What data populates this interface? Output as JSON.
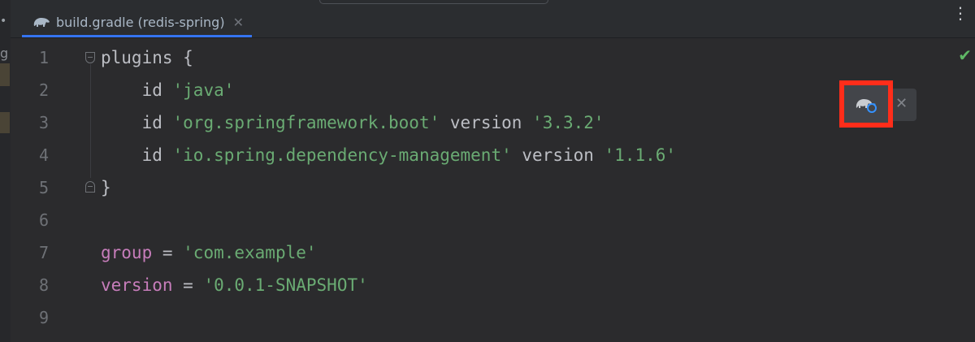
{
  "left_strip": {
    "letter": "g",
    "dot": "•"
  },
  "tab": {
    "title": "build.gradle (redis-spring)",
    "close": "✕",
    "icon": "gradle-elephant-icon"
  },
  "tabbar": {
    "more": "⋮"
  },
  "line_numbers": [
    "1",
    "2",
    "3",
    "4",
    "5",
    "6",
    "7",
    "8",
    "9"
  ],
  "code": {
    "l1": {
      "a": "plugins ",
      "b": "{"
    },
    "l2": {
      "a": "    id ",
      "b": "'java'"
    },
    "l3": {
      "a": "    id ",
      "b": "'org.springframework.boot'",
      "c": " version ",
      "d": "'3.3.2'"
    },
    "l4": {
      "a": "    id ",
      "b": "'io.spring.dependency-management'",
      "c": " version ",
      "d": "'1.1.6'"
    },
    "l5": {
      "a": "}"
    },
    "l7": {
      "a": "group",
      "b": " = ",
      "c": "'com.example'"
    },
    "l8": {
      "a": "version",
      "b": " = ",
      "c": "'0.0.1-SNAPSHOT'"
    }
  },
  "inspection": {
    "check": "✔",
    "status_color": "#5fb865"
  },
  "gradle_reload": {
    "icon": "gradle-reload-icon",
    "close": "✕",
    "highlight_color": "#ff2d1a"
  }
}
